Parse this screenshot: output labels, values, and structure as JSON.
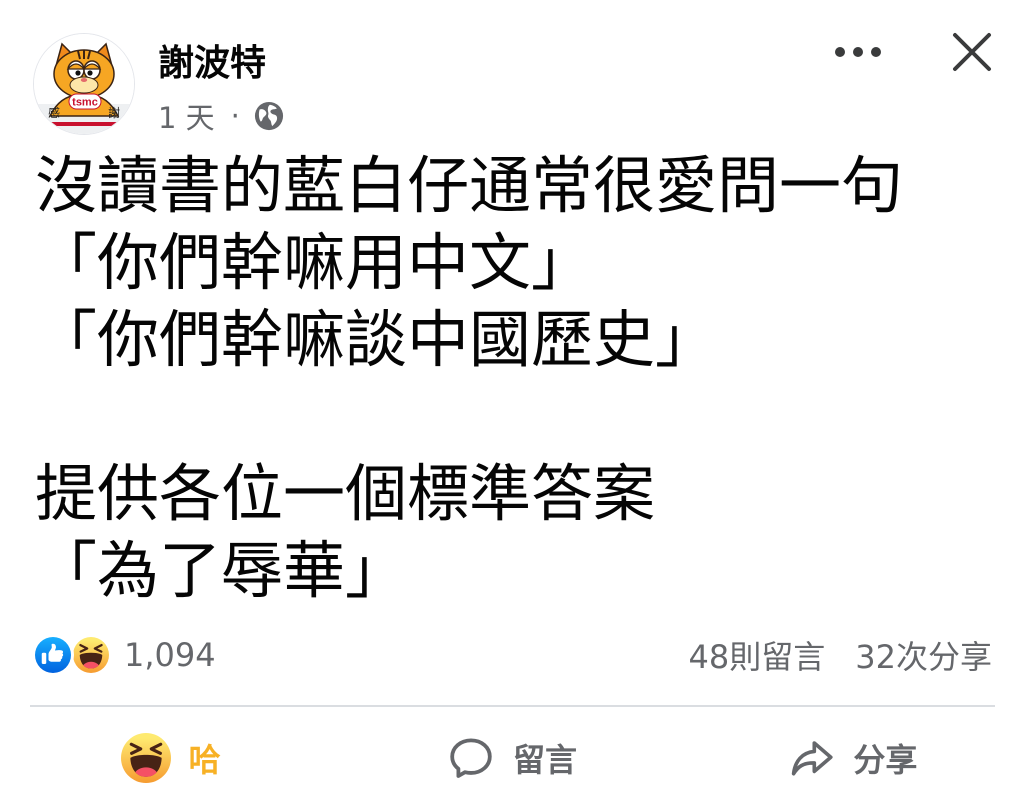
{
  "colors": {
    "text": "#050505",
    "secondary": "#65676b",
    "like_blue": "#1877f2",
    "haha_yellow": "#f7b125",
    "divider": "#dadde1",
    "background": "#ffffff"
  },
  "post": {
    "author": {
      "name": "謝波特",
      "avatar": {
        "logo_text": "tsmc",
        "left_char": "感",
        "right_char": "謝"
      }
    },
    "timestamp": "1 天",
    "separator": "·",
    "privacy_icon": "globe-icon",
    "header_actions": {
      "more_icon": "more-horizontal-icon",
      "close_icon": "close-icon"
    },
    "paragraphs": [
      [
        "沒讀書的藍白仔通常很愛問一句",
        "「你們幹嘛用中文」",
        "「你們幹嘛談中國歷史」"
      ],
      [
        "提供各位一個標準答案",
        "「為了辱華」"
      ]
    ],
    "reactions": {
      "icons": [
        "like-icon",
        "haha-icon"
      ],
      "count": "1,094"
    },
    "comments_count": "48則留言",
    "shares_count": "32次分享",
    "action_bar": [
      {
        "label": "哈",
        "icon": "haha-icon",
        "active": true
      },
      {
        "label": "留言",
        "icon": "comment-icon",
        "active": false
      },
      {
        "label": "分享",
        "icon": "share-icon",
        "active": false
      }
    ]
  }
}
